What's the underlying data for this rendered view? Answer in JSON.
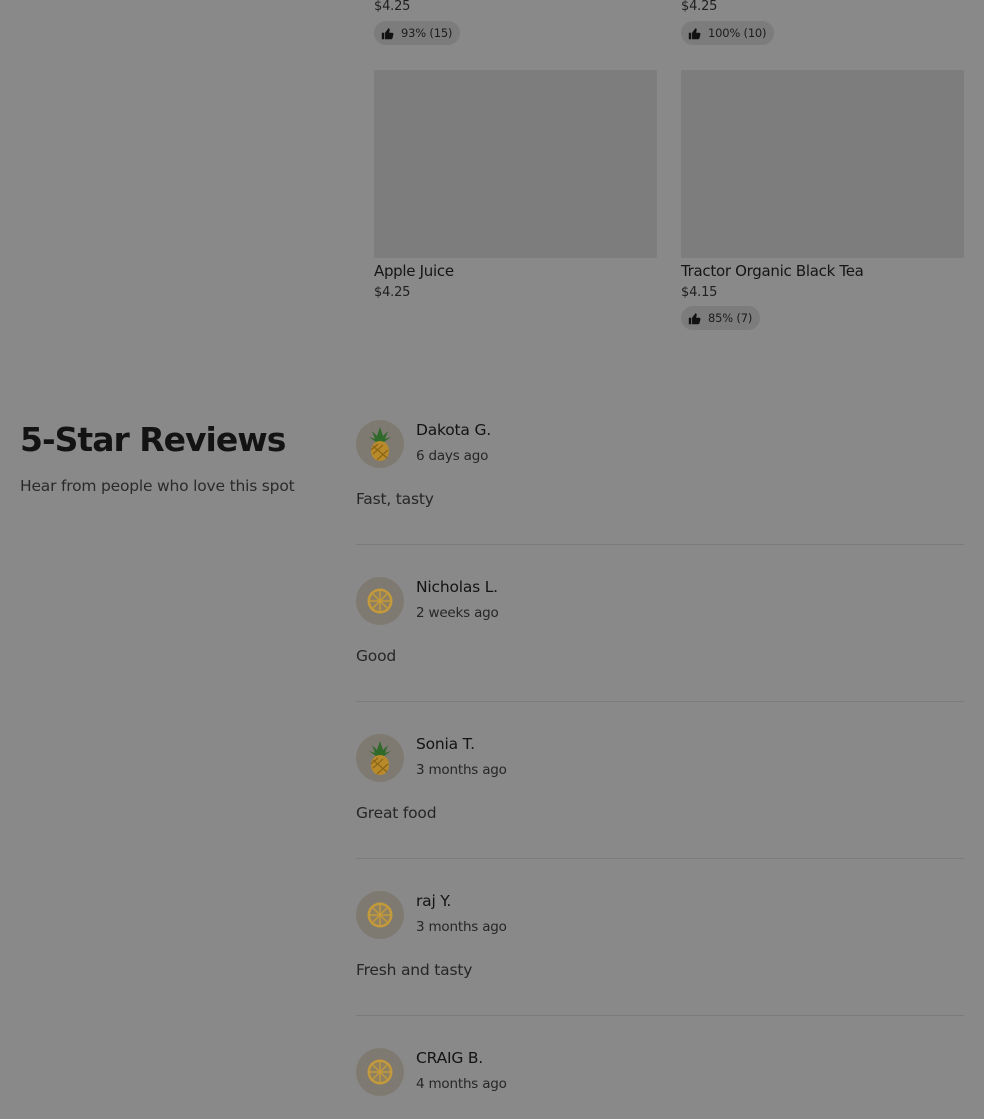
{
  "top_items": [
    {
      "price": "$4.25",
      "rating": "93% (15)"
    },
    {
      "price": "$4.25",
      "rating": "100% (10)"
    }
  ],
  "products": [
    {
      "name": "Apple Juice",
      "price": "$4.25",
      "rating": ""
    },
    {
      "name": "Tractor Organic Black Tea",
      "price": "$4.15",
      "rating": "85% (7)"
    }
  ],
  "reviews_section": {
    "title": "5-Star Reviews",
    "subtitle": "Hear from people who love this spot"
  },
  "reviews": [
    {
      "name": "Dakota G.",
      "time": "6 days ago",
      "text": "Fast, tasty",
      "avatar_icon": "pineapple-icon"
    },
    {
      "name": "Nicholas L.",
      "time": "2 weeks ago",
      "text": "Good",
      "avatar_icon": "citrus-slice-icon"
    },
    {
      "name": "Sonia T.",
      "time": "3 months ago",
      "text": "Great food",
      "avatar_icon": "pineapple-icon"
    },
    {
      "name": "raj Y.",
      "time": "3 months ago",
      "text": "Fresh and tasty",
      "avatar_icon": "citrus-slice-icon"
    },
    {
      "name": "CRAIG B.",
      "time": "4 months ago",
      "text": "",
      "avatar_icon": "citrus-slice-icon"
    }
  ],
  "colors": {
    "overlay_background": "#898989",
    "pineapple_body": "#b88a2a",
    "pineapple_leaves": "#2f6a2a",
    "citrus": "#c49a3a"
  }
}
